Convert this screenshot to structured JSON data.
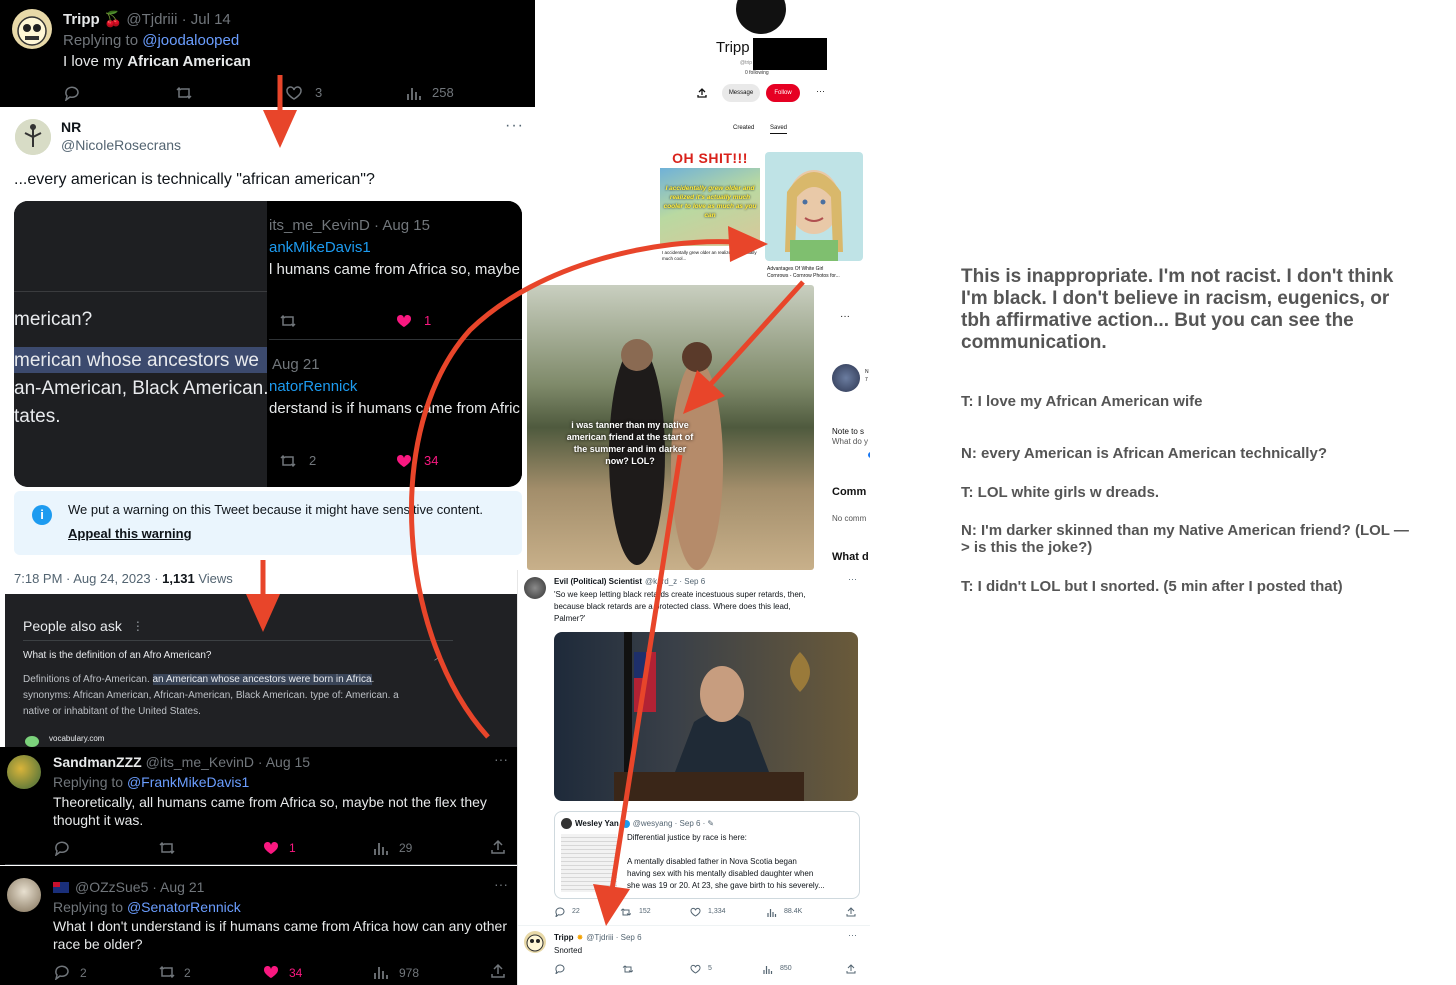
{
  "tweet1": {
    "name": "Tripp",
    "handle_date": "@Tjdriii · Jul 14",
    "replying_label": "Replying to",
    "replying_handle": "@joodalooped",
    "text_pre": "I love my ",
    "text_bold": "African American",
    "likes": "3",
    "views": "258"
  },
  "tweet2": {
    "name": "NR",
    "handle": "@NicoleRosecrans",
    "text": "...every american is technically \"african american\"?",
    "left_q": "merican?",
    "left_h1": "merican whose ancestors we",
    "left_h2": "an-American, Black American.",
    "left_h3": "tates.",
    "r1_handle_date": "its_me_KevinD · Aug 15",
    "r1_reply": "ankMikeDavis1",
    "r1_text": "l humans came from Africa so, maybe",
    "r1_likes": "1",
    "r2_date": "Aug 21",
    "r2_reply": "natorRennick",
    "r2_text": "derstand is if humans came from Afric",
    "r2_retweets": "2",
    "r2_likes": "34",
    "warning": "We put a warning on this Tweet because it might have sensitive content.",
    "appeal": "Appeal this warning",
    "meta_time": "7:18 PM · Aug 24, 2023 · ",
    "meta_views": "1,131",
    "meta_views_label": " Views"
  },
  "paa": {
    "title": "People also ask",
    "question": "What is the definition of an Afro American?",
    "def_pre": "Definitions of Afro-American. ",
    "def_hl": "an American whose ancestors were born in Africa",
    "def_post": ".",
    "def_line2": "synonyms: African American, African-American, Black American. type of: American. a",
    "def_line3": "native or inhabitant of the United States.",
    "source": "vocabulary.com"
  },
  "reply1": {
    "name": "SandmanZZZ",
    "handle_date": "@its_me_KevinD · Aug 15",
    "replying_label": "Replying to",
    "replying_handle": "@FrankMikeDavis1",
    "text1": "Theoretically, all humans came from Africa so, maybe not the flex they",
    "text2": "thought it was.",
    "likes": "1",
    "views": "29"
  },
  "reply2": {
    "handle_date": "@OZzSue5 · Aug 21",
    "replying_label": "Replying to",
    "replying_handle": "@SenatorRennick",
    "text1": "What I don't understand is if humans came from Africa how can any other",
    "text2": "race be older?",
    "replies": "2",
    "retweets": "2",
    "likes": "34",
    "views": "978"
  },
  "pinterest": {
    "name": "Tripp",
    "sub1": "@trip",
    "following": "0 following",
    "message": "Message",
    "follow": "Follow",
    "tab_created": "Created",
    "tab_saved": "Saved",
    "meme_title": "OH SHIT!!!",
    "meme_text": "I accidentally grew older and realized it's actually much cooler to love as much as you can",
    "meme_caption": "I accidentally grew older an realized it's actually much cool...",
    "girl_caption1": "Advantages Of White Girl",
    "girl_caption2": "Cornrows - Cornrow Photos for...",
    "photo_caption": "i was tanner than my native american friend at the start of the summer and im darker now? LOL?",
    "side_note1": "Note to s",
    "side_note2": "What do y",
    "side_comments": "Comm",
    "side_nocomments": "No comm",
    "side_what": "What d",
    "side_n": "N",
    "side_7": "7"
  },
  "tweet3": {
    "name": "Evil (Political) Scientist",
    "handle_date": "@k_rd_z · Sep 6",
    "text1": "'So we keep letting black retards create incestuous super retards, then,",
    "text2": "because black retards are a protected class. Where does this lead,",
    "text3": "Palmer?'",
    "quote_name": "Wesley Yan",
    "quote_handle_date": "@wesyang · Sep 6 · ",
    "quote_line1": "Differential justice by race is here:",
    "quote_line2": "A mentally disabled father in Nova Scotia began",
    "quote_line3": "having sex with his mentally disabled daughter when",
    "quote_line4": "she was 19 or 20. At 23, she gave birth to his severely...",
    "replies": "22",
    "retweets": "152",
    "likes": "1,334",
    "views": "88.4K"
  },
  "tweet4": {
    "name": "Tripp",
    "handle_date": "@Tjdriii · Sep 6",
    "text": "Snorted",
    "likes": "5",
    "views": "850"
  },
  "notes": {
    "para1": "This is inappropriate. I'm not racist. I don't think I'm black. I don't believe in racism, eugenics, or tbh affirmative action... But you can see the communication.",
    "t1": "T: I love my African American wife",
    "n1": "N: every American is African American technically?",
    "t2": "T: LOL white girls w dreads.",
    "n2": "N: I'm darker skinned than my Native American friend? (LOL —> is this the joke?)",
    "t3": "T: I didn't LOL but I snorted. (5 min after I posted that)"
  },
  "colors": {
    "arrow": "#e8452a",
    "link": "#1d9bf0",
    "like": "#f91880",
    "follow": "#e60023",
    "notes_text": "#555555"
  }
}
